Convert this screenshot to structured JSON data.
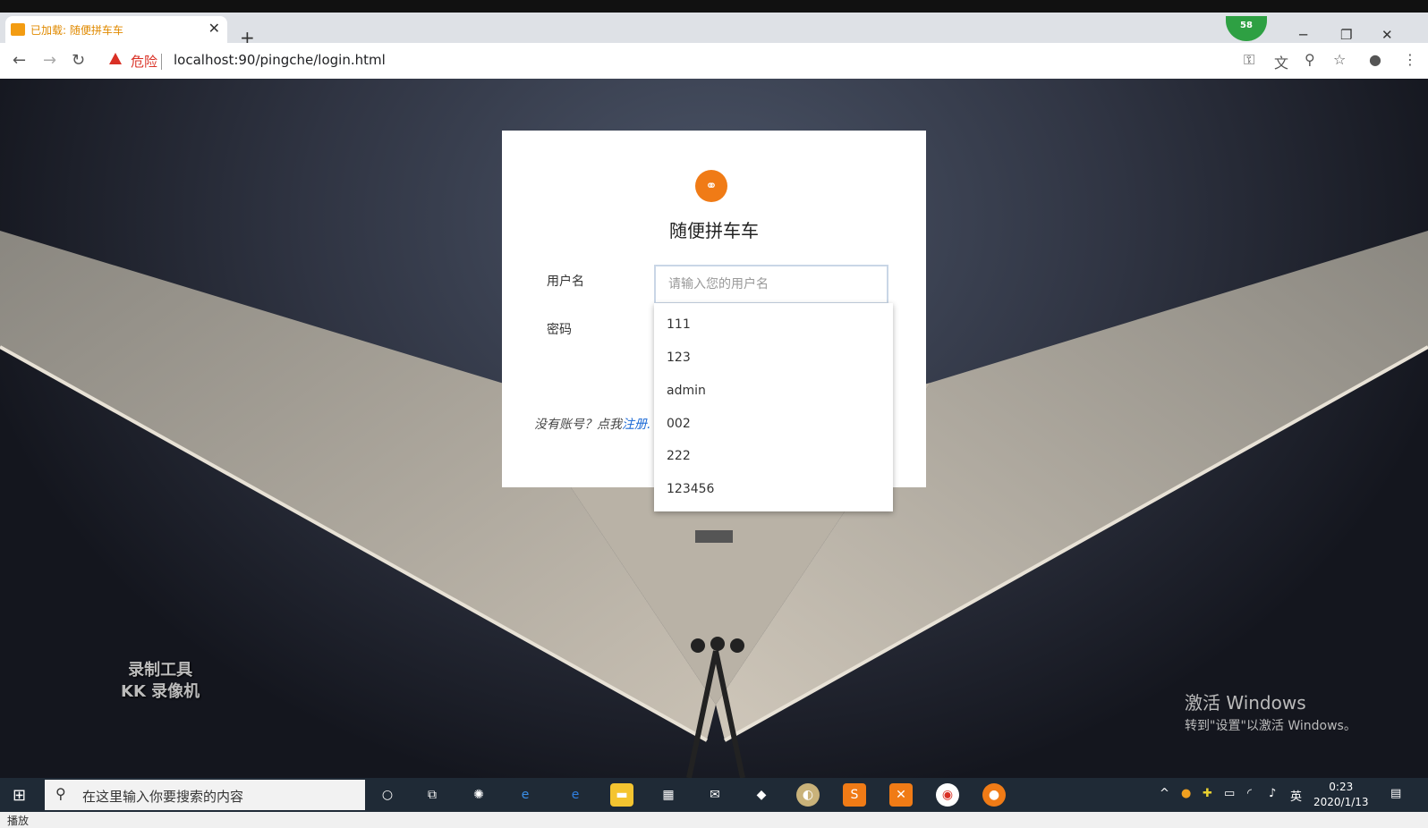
{
  "browser": {
    "tab_title": "已加载: 随便拼车车",
    "new_tab": "+",
    "profile_badge": "58",
    "security_label": "危险",
    "url": "localhost:90/pingche/login.html"
  },
  "login": {
    "logo_icon": "car-icon",
    "site_title": "随便拼车车",
    "username_label": "用户名",
    "username_placeholder": "请输入您的用户名",
    "password_label": "密码",
    "register_prefix": "没有账号？点我",
    "register_link": "注册."
  },
  "autocomplete": {
    "items": [
      "111",
      "123",
      "admin",
      "002",
      "222",
      "123456"
    ]
  },
  "watermark": {
    "line1": "录制工具",
    "line2": "KK 录像机"
  },
  "activation": {
    "title": "激活 Windows",
    "subtitle": "转到\"设置\"以激活 Windows。"
  },
  "taskbar": {
    "search_placeholder": "在这里输入你要搜索的内容",
    "ime": "英",
    "time": "0:23",
    "date": "2020/1/13"
  },
  "status": {
    "text": "播放"
  },
  "colors": {
    "accent": "#f07b16",
    "link": "#1e6bd6",
    "danger": "#d93025"
  }
}
